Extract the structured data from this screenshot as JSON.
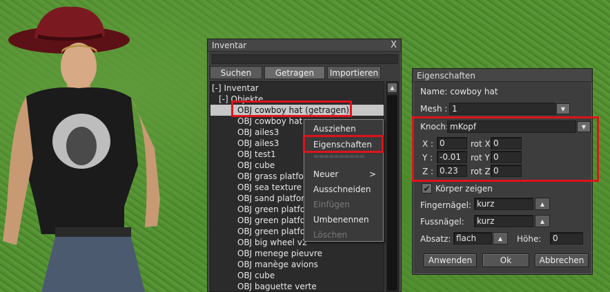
{
  "colors": {
    "highlight": "#e0121c",
    "panel": "#3d3d3d",
    "selection": "#c7c7c7"
  },
  "inventory": {
    "title": "Inventar",
    "close": "X",
    "tabs": [
      "Suchen",
      "Getragen",
      "Importieren"
    ],
    "tree": {
      "root": "[-] Inventar",
      "folder": "[-] Objekte",
      "items": [
        "OBJ cowboy hat (getragen)",
        "OBJ cowboy hat",
        "OBJ ailes3",
        "OBJ ailes3",
        "OBJ test1",
        "OBJ cube",
        "OBJ grass platfor",
        "OBJ sea texture",
        "OBJ sand platfor",
        "OBJ green platfor",
        "OBJ green platfor",
        "OBJ green platfor",
        "OBJ big wheel v2",
        "OBJ menege pieuvre",
        "OBJ manège avions",
        "OBJ cube",
        "OBJ baguette verte"
      ]
    },
    "scroll_up": "▲"
  },
  "context_menu": {
    "items": [
      "Ausziehen",
      "Eigenschaften"
    ],
    "separator": "==========",
    "more": [
      "Neuer",
      "Ausschneiden",
      "Einfügen",
      "Umbenennen",
      "Löschen"
    ],
    "submenu_arrow": ">",
    "disabled": [
      "Einfügen",
      "Löschen"
    ]
  },
  "properties": {
    "title": "Eigenschaften",
    "name_label": "Name: cowboy hat",
    "mesh_label": "Mesh :",
    "mesh_value": "1",
    "knoch_label": "Knoch:",
    "knoch_value": "mKopf",
    "x_label": "X :",
    "x_value": "0",
    "y_label": "Y :",
    "y_value": "-0.01",
    "z_label": "Z :",
    "z_value": "0.23",
    "rotx_label": "rot X",
    "rotx_value": "0",
    "roty_label": "rot Y",
    "roty_value": "0",
    "rotz_label": "rot Z",
    "rotz_value": "0",
    "show_body_label": "Körper zeigen",
    "show_body_checked": true,
    "fingernails_label": "Fingernägel:",
    "fingernails_value": "kurz",
    "toenails_label": "Fussnägel:",
    "toenails_value": "kurz",
    "heel_label": "Absatz:",
    "heel_value": "flach",
    "height_label": "Höhe:",
    "height_value": "0",
    "check_mark": "✔",
    "dd_arrow": "▼",
    "up_arrow": "▲",
    "buttons": {
      "apply": "Anwenden",
      "ok": "Ok",
      "cancel": "Abbrechen"
    }
  }
}
